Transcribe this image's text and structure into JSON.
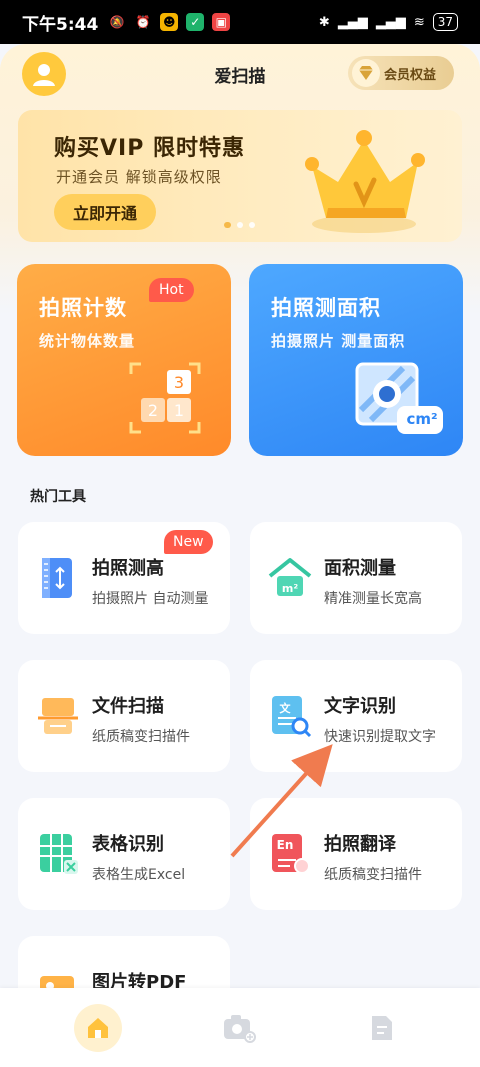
{
  "status_bar": {
    "time": "下午5:44",
    "battery": "37"
  },
  "header": {
    "title": "爱扫描",
    "vip_label": "会员权益"
  },
  "banner": {
    "title": "购买VIP 限时特惠",
    "subtitle": "开通会员 解锁高级权限",
    "button": "立即开通",
    "page_count": 3,
    "active_page": 1
  },
  "feature_cards": [
    {
      "title": "拍照计数",
      "subtitle": "统计物体数量",
      "badge": "Hot",
      "icon": "count-blocks-icon",
      "color": "#ff9a35"
    },
    {
      "title": "拍照测面积",
      "subtitle": "拍摄照片 测量面积",
      "icon": "area-measure-icon",
      "unit": "cm²",
      "color": "#3d97fb"
    }
  ],
  "section": {
    "title": "热门工具"
  },
  "tools": [
    {
      "name": "拍照测高",
      "desc": "拍摄照片 自动测量",
      "badge": "New",
      "icon": "ruler-icon"
    },
    {
      "name": "面积测量",
      "desc": "精准测量长宽高",
      "icon": "house-area-icon",
      "icon_text": "m²"
    },
    {
      "name": "文件扫描",
      "desc": "纸质稿变扫描件",
      "icon": "file-scan-icon"
    },
    {
      "name": "文字识别",
      "desc": "快速识别提取文字",
      "icon": "text-ocr-icon",
      "icon_text": "文"
    },
    {
      "name": "表格识别",
      "desc": "表格生成Excel",
      "icon": "table-excel-icon"
    },
    {
      "name": "拍照翻译",
      "desc": "纸质稿变扫描件",
      "icon": "translate-icon",
      "icon_text": "En"
    },
    {
      "name": "图片转PDF",
      "desc": "",
      "icon": "image-pdf-icon"
    }
  ],
  "bottom_nav": [
    {
      "name": "home",
      "icon": "home-icon",
      "active": true
    },
    {
      "name": "camera",
      "icon": "camera-icon",
      "active": false
    },
    {
      "name": "documents",
      "icon": "document-icon",
      "active": false
    }
  ]
}
